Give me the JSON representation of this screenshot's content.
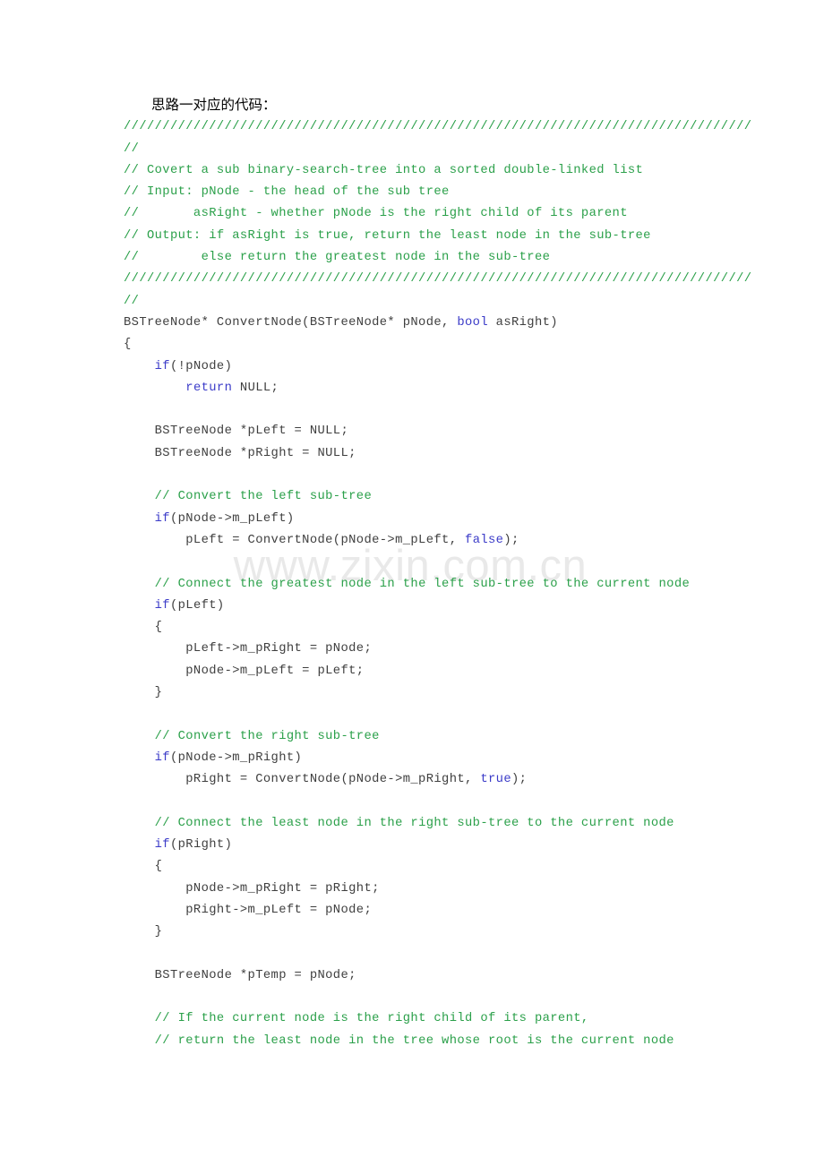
{
  "document": {
    "heading_cjk": "思路一对应的代码：",
    "watermark": "www.zixin.com.cn",
    "colors": {
      "comment": "#2ba04a",
      "keyword": "#3b3bc8",
      "code": "#3f3f3f",
      "watermark": "#e9e9e9",
      "page_background": "#ffffff"
    },
    "separator": "/////////////////////////////////////////////////////////////////////////////////"
  },
  "code": {
    "language": "cpp",
    "lines": [
      {
        "id": 1,
        "indent": 0,
        "tokens": [
          {
            "t": "c",
            "s": "/////////////////////////////////////////////////////////////////////////////////"
          }
        ]
      },
      {
        "id": 2,
        "indent": 0,
        "tokens": [
          {
            "t": "c",
            "s": "//"
          }
        ]
      },
      {
        "id": 3,
        "indent": 0,
        "tokens": [
          {
            "t": "c",
            "s": "// Covert a sub binary-search-tree into a sorted double-linked list"
          }
        ]
      },
      {
        "id": 4,
        "indent": 0,
        "tokens": [
          {
            "t": "c",
            "s": "// Input: pNode - the head of the sub tree"
          }
        ]
      },
      {
        "id": 5,
        "indent": 0,
        "tokens": [
          {
            "t": "c",
            "s": "//       asRight - whether pNode is the right child of its parent"
          }
        ]
      },
      {
        "id": 6,
        "indent": 0,
        "tokens": [
          {
            "t": "c",
            "s": "// Output: if asRight is true, return the least node in the sub-tree"
          }
        ]
      },
      {
        "id": 7,
        "indent": 0,
        "tokens": [
          {
            "t": "c",
            "s": "//        else return the greatest node in the sub-tree"
          }
        ]
      },
      {
        "id": 8,
        "indent": 0,
        "tokens": [
          {
            "t": "c",
            "s": "/////////////////////////////////////////////////////////////////////////////////"
          }
        ]
      },
      {
        "id": 9,
        "indent": 0,
        "tokens": [
          {
            "t": "c",
            "s": "//"
          }
        ]
      },
      {
        "id": 10,
        "indent": 0,
        "tokens": [
          {
            "t": "p",
            "s": "BSTreeNode* ConvertNode(BSTreeNode* pNode, "
          },
          {
            "t": "k",
            "s": "bool"
          },
          {
            "t": "p",
            "s": " asRight)"
          }
        ]
      },
      {
        "id": 11,
        "indent": 0,
        "tokens": [
          {
            "t": "p",
            "s": "{"
          }
        ]
      },
      {
        "id": 12,
        "indent": 0,
        "tokens": [
          {
            "t": "p",
            "s": "    "
          },
          {
            "t": "k",
            "s": "if"
          },
          {
            "t": "p",
            "s": "(!pNode)"
          }
        ]
      },
      {
        "id": 13,
        "indent": 0,
        "tokens": [
          {
            "t": "p",
            "s": "        "
          },
          {
            "t": "k",
            "s": "return"
          },
          {
            "t": "p",
            "s": " NULL;"
          }
        ]
      },
      {
        "id": 14,
        "indent": 0,
        "tokens": [
          {
            "t": "p",
            "s": " "
          }
        ]
      },
      {
        "id": 15,
        "indent": 0,
        "tokens": [
          {
            "t": "p",
            "s": "    BSTreeNode *pLeft = NULL;"
          }
        ]
      },
      {
        "id": 16,
        "indent": 0,
        "tokens": [
          {
            "t": "p",
            "s": "    BSTreeNode *pRight = NULL;"
          }
        ]
      },
      {
        "id": 17,
        "indent": 0,
        "tokens": [
          {
            "t": "p",
            "s": " "
          }
        ]
      },
      {
        "id": 18,
        "indent": 0,
        "tokens": [
          {
            "t": "p",
            "s": "    "
          },
          {
            "t": "c",
            "s": "// Convert the left sub-tree"
          }
        ]
      },
      {
        "id": 19,
        "indent": 0,
        "tokens": [
          {
            "t": "p",
            "s": "    "
          },
          {
            "t": "k",
            "s": "if"
          },
          {
            "t": "p",
            "s": "(pNode->m_pLeft)"
          }
        ]
      },
      {
        "id": 20,
        "indent": 0,
        "tokens": [
          {
            "t": "p",
            "s": "        pLeft = ConvertNode(pNode->m_pLeft, "
          },
          {
            "t": "k",
            "s": "false"
          },
          {
            "t": "p",
            "s": ");"
          }
        ]
      },
      {
        "id": 21,
        "indent": 0,
        "tokens": [
          {
            "t": "p",
            "s": " "
          }
        ]
      },
      {
        "id": 22,
        "indent": 0,
        "tokens": [
          {
            "t": "p",
            "s": "    "
          },
          {
            "t": "c",
            "s": "// Connect the greatest node in the left sub-tree to the current node"
          }
        ]
      },
      {
        "id": 23,
        "indent": 0,
        "tokens": [
          {
            "t": "p",
            "s": "    "
          },
          {
            "t": "k",
            "s": "if"
          },
          {
            "t": "p",
            "s": "(pLeft)"
          }
        ]
      },
      {
        "id": 24,
        "indent": 0,
        "tokens": [
          {
            "t": "p",
            "s": "    {"
          }
        ]
      },
      {
        "id": 25,
        "indent": 0,
        "tokens": [
          {
            "t": "p",
            "s": "        pLeft->m_pRight = pNode;"
          }
        ]
      },
      {
        "id": 26,
        "indent": 0,
        "tokens": [
          {
            "t": "p",
            "s": "        pNode->m_pLeft = pLeft;"
          }
        ]
      },
      {
        "id": 27,
        "indent": 0,
        "tokens": [
          {
            "t": "p",
            "s": "    }"
          }
        ]
      },
      {
        "id": 28,
        "indent": 0,
        "tokens": [
          {
            "t": "p",
            "s": " "
          }
        ]
      },
      {
        "id": 29,
        "indent": 0,
        "tokens": [
          {
            "t": "p",
            "s": "    "
          },
          {
            "t": "c",
            "s": "// Convert the right sub-tree"
          }
        ]
      },
      {
        "id": 30,
        "indent": 0,
        "tokens": [
          {
            "t": "p",
            "s": "    "
          },
          {
            "t": "k",
            "s": "if"
          },
          {
            "t": "p",
            "s": "(pNode->m_pRight)"
          }
        ]
      },
      {
        "id": 31,
        "indent": 0,
        "tokens": [
          {
            "t": "p",
            "s": "        pRight = ConvertNode(pNode->m_pRight, "
          },
          {
            "t": "k",
            "s": "true"
          },
          {
            "t": "p",
            "s": ");"
          }
        ]
      },
      {
        "id": 32,
        "indent": 0,
        "tokens": [
          {
            "t": "p",
            "s": " "
          }
        ]
      },
      {
        "id": 33,
        "indent": 0,
        "tokens": [
          {
            "t": "p",
            "s": "    "
          },
          {
            "t": "c",
            "s": "// Connect the least node in the right sub-tree to the current node"
          }
        ]
      },
      {
        "id": 34,
        "indent": 0,
        "tokens": [
          {
            "t": "p",
            "s": "    "
          },
          {
            "t": "k",
            "s": "if"
          },
          {
            "t": "p",
            "s": "(pRight)"
          }
        ]
      },
      {
        "id": 35,
        "indent": 0,
        "tokens": [
          {
            "t": "p",
            "s": "    {"
          }
        ]
      },
      {
        "id": 36,
        "indent": 0,
        "tokens": [
          {
            "t": "p",
            "s": "        pNode->m_pRight = pRight;"
          }
        ]
      },
      {
        "id": 37,
        "indent": 0,
        "tokens": [
          {
            "t": "p",
            "s": "        pRight->m_pLeft = pNode;"
          }
        ]
      },
      {
        "id": 38,
        "indent": 0,
        "tokens": [
          {
            "t": "p",
            "s": "    }"
          }
        ]
      },
      {
        "id": 39,
        "indent": 0,
        "tokens": [
          {
            "t": "p",
            "s": " "
          }
        ]
      },
      {
        "id": 40,
        "indent": 0,
        "tokens": [
          {
            "t": "p",
            "s": "    BSTreeNode *pTemp = pNode;"
          }
        ]
      },
      {
        "id": 41,
        "indent": 0,
        "tokens": [
          {
            "t": "p",
            "s": " "
          }
        ]
      },
      {
        "id": 42,
        "indent": 0,
        "tokens": [
          {
            "t": "p",
            "s": "    "
          },
          {
            "t": "c",
            "s": "// If the current node is the right child of its parent,"
          }
        ]
      },
      {
        "id": 43,
        "indent": 0,
        "tokens": [
          {
            "t": "p",
            "s": "    "
          },
          {
            "t": "c",
            "s": "// return the least node in the tree whose root is the current node"
          }
        ]
      }
    ]
  }
}
